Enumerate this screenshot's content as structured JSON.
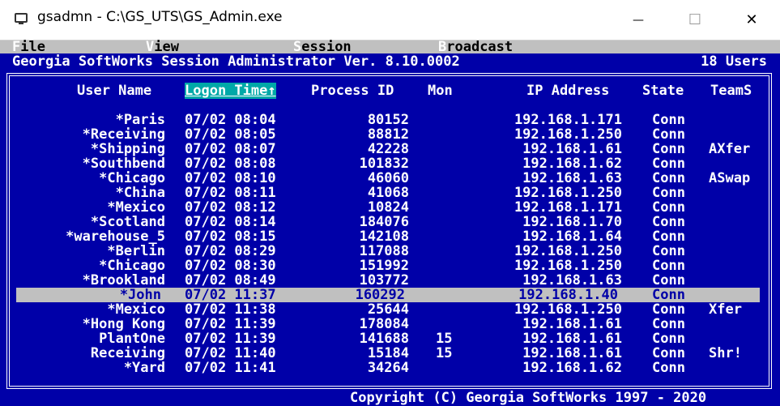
{
  "window": {
    "title": "gsadmn - C:\\GS_UTS\\GS_Admin.exe",
    "minimize_glyph": "—",
    "maximize_glyph": "☐",
    "close_glyph": "✕"
  },
  "menu": {
    "file": {
      "hot": "F",
      "rest": "ile"
    },
    "view": {
      "hot": "V",
      "rest": "iew"
    },
    "session": {
      "hot": "S",
      "rest": "ession"
    },
    "broadcast": {
      "hot": "B",
      "rest": "roadcast"
    }
  },
  "header": {
    "app_title": "Georgia SoftWorks Session Administrator Ver. 8.10.0002",
    "user_count": "18 Users"
  },
  "columns": {
    "user_name": "User Name",
    "logon_time": "Logon Time↑",
    "process_id": "Process ID",
    "mon": "Mon",
    "ip_address": "IP Address",
    "state": "State",
    "teams": "TeamS"
  },
  "rows": [
    {
      "user": "*Paris",
      "logon": "07/02 08:04",
      "pid": "80152",
      "mon": "",
      "ip": "192.168.1.171",
      "state": "Conn",
      "teams": ""
    },
    {
      "user": "*Receiving",
      "logon": "07/02 08:05",
      "pid": "88812",
      "mon": "",
      "ip": "192.168.1.250",
      "state": "Conn",
      "teams": ""
    },
    {
      "user": "*Shipping",
      "logon": "07/02 08:07",
      "pid": "42228",
      "mon": "",
      "ip": "192.168.1.61",
      "state": "Conn",
      "teams": "AXfer"
    },
    {
      "user": "*Southbend",
      "logon": "07/02 08:08",
      "pid": "101832",
      "mon": "",
      "ip": "192.168.1.62",
      "state": "Conn",
      "teams": ""
    },
    {
      "user": "*Chicago",
      "logon": "07/02 08:10",
      "pid": "46060",
      "mon": "",
      "ip": "192.168.1.63",
      "state": "Conn",
      "teams": "ASwap"
    },
    {
      "user": "*China",
      "logon": "07/02 08:11",
      "pid": "41068",
      "mon": "",
      "ip": "192.168.1.250",
      "state": "Conn",
      "teams": ""
    },
    {
      "user": "*Mexico",
      "logon": "07/02 08:12",
      "pid": "10824",
      "mon": "",
      "ip": "192.168.1.171",
      "state": "Conn",
      "teams": ""
    },
    {
      "user": "*Scotland",
      "logon": "07/02 08:14",
      "pid": "184076",
      "mon": "",
      "ip": "192.168.1.70",
      "state": "Conn",
      "teams": ""
    },
    {
      "user": "*warehouse_5",
      "logon": "07/02 08:15",
      "pid": "142108",
      "mon": "",
      "ip": "192.168.1.64",
      "state": "Conn",
      "teams": ""
    },
    {
      "user": "*Berlin",
      "logon": "07/02 08:29",
      "pid": "117088",
      "mon": "",
      "ip": "192.168.1.250",
      "state": "Conn",
      "teams": ""
    },
    {
      "user": "*Chicago",
      "logon": "07/02 08:30",
      "pid": "151992",
      "mon": "",
      "ip": "192.168.1.250",
      "state": "Conn",
      "teams": ""
    },
    {
      "user": "*Brookland",
      "logon": "07/02 08:49",
      "pid": "103772",
      "mon": "",
      "ip": "192.168.1.63",
      "state": "Conn",
      "teams": ""
    },
    {
      "user": "*John",
      "logon": "07/02 11:37",
      "pid": "160292",
      "mon": "",
      "ip": "192.168.1.40",
      "state": "Conn",
      "teams": "",
      "selected": true
    },
    {
      "user": "*Mexico",
      "logon": "07/02 11:38",
      "pid": "25644",
      "mon": "",
      "ip": "192.168.1.250",
      "state": "Conn",
      "teams": "Xfer"
    },
    {
      "user": "*Hong Kong",
      "logon": "07/02 11:39",
      "pid": "178084",
      "mon": "",
      "ip": "192.168.1.61",
      "state": "Conn",
      "teams": ""
    },
    {
      "user": "PlantOne",
      "logon": "07/02 11:39",
      "pid": "141688",
      "mon": "15",
      "ip": "192.168.1.61",
      "state": "Conn",
      "teams": ""
    },
    {
      "user": "Receiving",
      "logon": "07/02 11:40",
      "pid": "15184",
      "mon": "15",
      "ip": "192.168.1.61",
      "state": "Conn",
      "teams": "Shr!"
    },
    {
      "user": "*Yard",
      "logon": "07/02 11:41",
      "pid": "34264",
      "mon": "",
      "ip": "192.168.1.62",
      "state": "Conn",
      "teams": ""
    }
  ],
  "footer": {
    "copyright": "Copyright (C) Georgia SoftWorks 1997 - 2020"
  },
  "colors": {
    "console_bg": "#0000a8",
    "menu_bg": "#c0c0c0",
    "selected_row_bg": "#c0c0c0",
    "sort_header_bg": "#00a8a8",
    "text": "#ffffff"
  }
}
